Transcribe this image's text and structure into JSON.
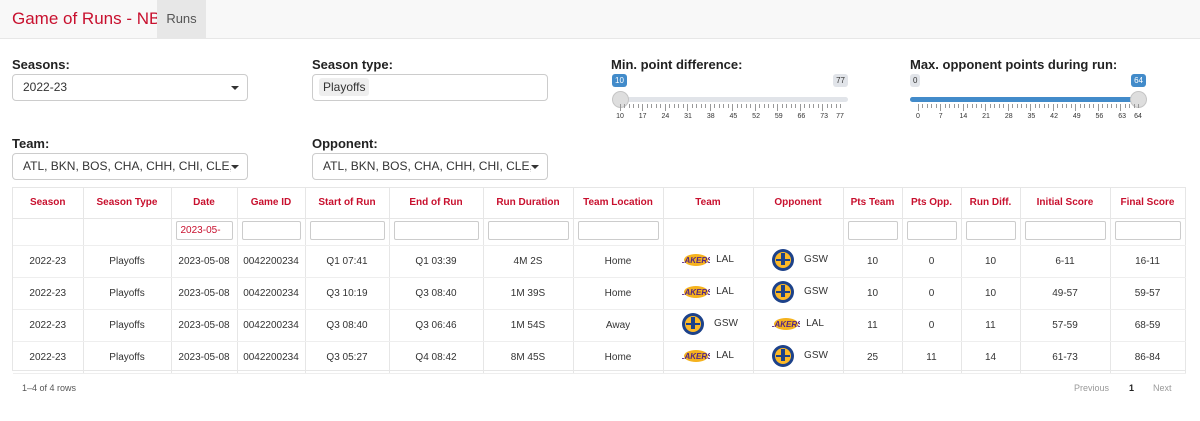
{
  "navbar": {
    "title": "Game of Runs - NBA",
    "tab_runs": "Runs"
  },
  "filters": {
    "seasons": {
      "label": "Seasons:",
      "value": "2022-23"
    },
    "season_type": {
      "label": "Season type:",
      "value": "Playoffs"
    },
    "min_point_diff": {
      "label": "Min. point difference:",
      "value": 10,
      "min": 10,
      "max": 77,
      "min_label": "10",
      "max_label": "77",
      "tick_labels": [
        "10",
        "17",
        "24",
        "31",
        "38",
        "45",
        "52",
        "59",
        "66",
        "73",
        "77"
      ]
    },
    "max_opp_points": {
      "label": "Max. opponent points during run:",
      "low": 0,
      "high": 64,
      "min": 0,
      "max": 64,
      "low_label": "0",
      "high_label": "64",
      "tick_labels": [
        "0",
        "7",
        "14",
        "21",
        "28",
        "35",
        "42",
        "49",
        "56",
        "63",
        "64"
      ]
    },
    "team": {
      "label": "Team:",
      "value": "ATL, BKN, BOS, CHA, CHH, CHI, CLE, DAL"
    },
    "opponent": {
      "label": "Opponent:",
      "value": "ATL, BKN, BOS, CHA, CHH, CHI, CLE, DAL"
    }
  },
  "table": {
    "headers": [
      "Season",
      "Season Type",
      "Date",
      "Game ID",
      "Start of Run",
      "End of Run",
      "Run Duration",
      "Team Location",
      "Team",
      "Opponent",
      "Pts Team",
      "Pts Opp.",
      "Run Diff.",
      "Initial Score",
      "Final Score"
    ],
    "date_filter": "2023-05-",
    "rows": [
      {
        "season": "2022-23",
        "season_type": "Playoffs",
        "date": "2023-05-08",
        "game_id": "0042200234",
        "start": "Q1 07:41",
        "end": "Q1 03:39",
        "duration": "4M 2S",
        "location": "Home",
        "team": "LAL",
        "team_logo": "lakers-logo",
        "opponent": "GSW",
        "opp_logo": "warriors-logo",
        "pts_team": "10",
        "pts_opp": "0",
        "run_diff": "10",
        "initial": "6-11",
        "final": "16-11"
      },
      {
        "season": "2022-23",
        "season_type": "Playoffs",
        "date": "2023-05-08",
        "game_id": "0042200234",
        "start": "Q3 10:19",
        "end": "Q3 08:40",
        "duration": "1M 39S",
        "location": "Home",
        "team": "LAL",
        "team_logo": "lakers-logo",
        "opponent": "GSW",
        "opp_logo": "warriors-logo",
        "pts_team": "10",
        "pts_opp": "0",
        "run_diff": "10",
        "initial": "49-57",
        "final": "59-57"
      },
      {
        "season": "2022-23",
        "season_type": "Playoffs",
        "date": "2023-05-08",
        "game_id": "0042200234",
        "start": "Q3 08:40",
        "end": "Q3 06:46",
        "duration": "1M 54S",
        "location": "Away",
        "team": "GSW",
        "team_logo": "warriors-logo",
        "opponent": "LAL",
        "opp_logo": "lakers-logo",
        "pts_team": "11",
        "pts_opp": "0",
        "run_diff": "11",
        "initial": "57-59",
        "final": "68-59"
      },
      {
        "season": "2022-23",
        "season_type": "Playoffs",
        "date": "2023-05-08",
        "game_id": "0042200234",
        "start": "Q3 05:27",
        "end": "Q4 08:42",
        "duration": "8M 45S",
        "location": "Home",
        "team": "LAL",
        "team_logo": "lakers-logo",
        "opponent": "GSW",
        "opp_logo": "warriors-logo",
        "pts_team": "25",
        "pts_opp": "11",
        "run_diff": "14",
        "initial": "61-73",
        "final": "86-84"
      }
    ]
  },
  "footer": {
    "row_count": "1–4 of 4 rows",
    "previous": "Previous",
    "page": "1",
    "next": "Next"
  },
  "colors": {
    "accent": "#c8102e",
    "slider": "#428bca"
  }
}
